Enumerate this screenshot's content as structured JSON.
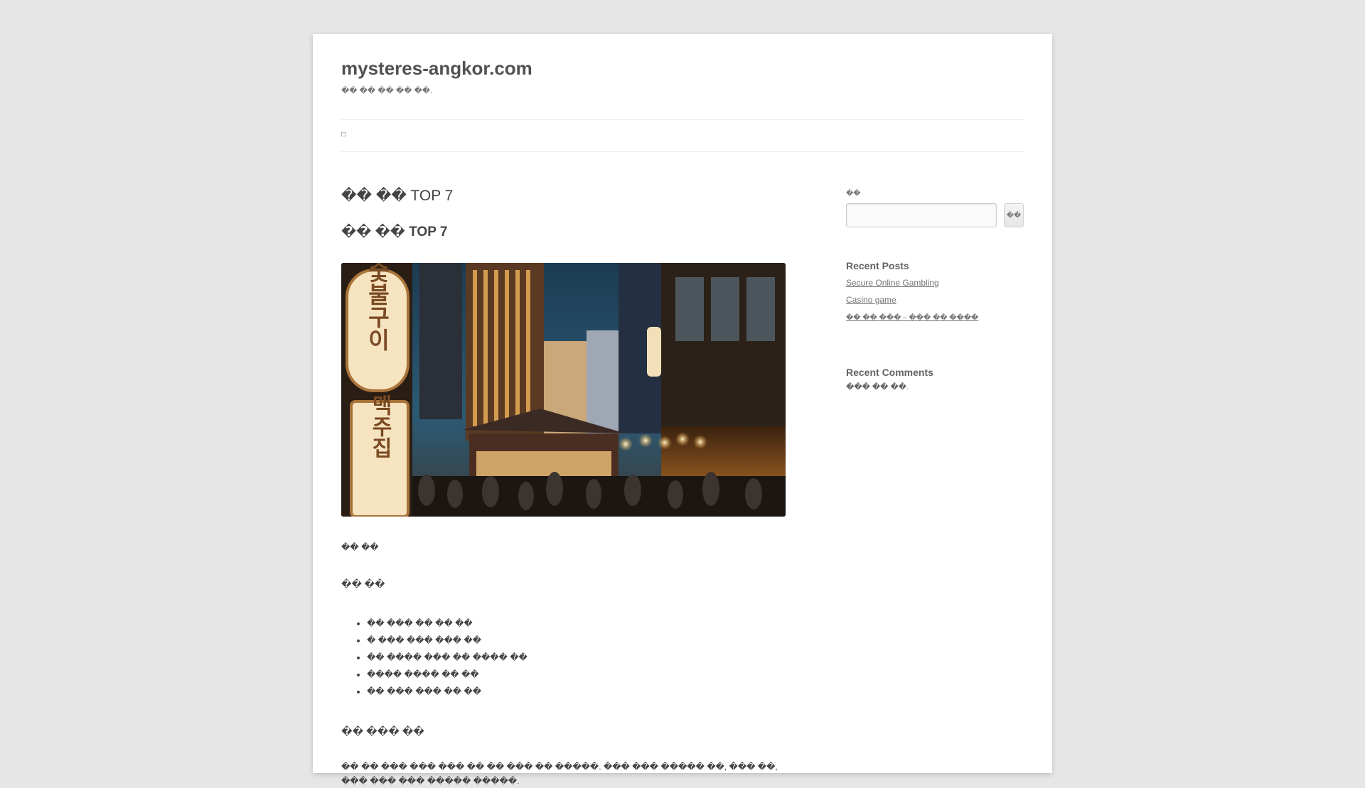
{
  "site": {
    "title": "mysteres-angkor.com",
    "description": "�� �� �� �� ��."
  },
  "nav": {
    "toggle": "□"
  },
  "article": {
    "title": "�� �� TOP 7",
    "heading": "�� �� TOP 7",
    "hero_alt": "night street with glowing Korean signboards and restaurants",
    "hero_sign_1": "숯불구이",
    "hero_sign_2": "맥주집",
    "toc_label": "�� ��",
    "toc_heading": "�� ��",
    "toc_items": [
      "�� ��� �� �� ��",
      "� ��� ��� ��� ��",
      "�� ���� ��� �� ���� ��",
      "���� ���� �� ��",
      "�� ��� ��� �� ��"
    ],
    "section_heading": "�� ��� ��",
    "paragraph": "�� �� ��� ��� ��� �� �� ��� �� �����. ��� ��� ����� ��, ��� ��, ��� ��� ��� ����� �����."
  },
  "sidebar": {
    "search_label": "��",
    "search_value": "",
    "search_button": "��",
    "recent_posts_title": "Recent Posts",
    "recent_posts": [
      "Secure Online Gambling",
      "Casino game",
      "�� �� ��� – ��� �� ����"
    ],
    "recent_comments_title": "Recent Comments",
    "no_comments": "��� �� ��."
  },
  "colors": {
    "page_bg": "#e6e6e6",
    "content_bg": "#ffffff",
    "text": "#444444",
    "link": "#757575"
  }
}
